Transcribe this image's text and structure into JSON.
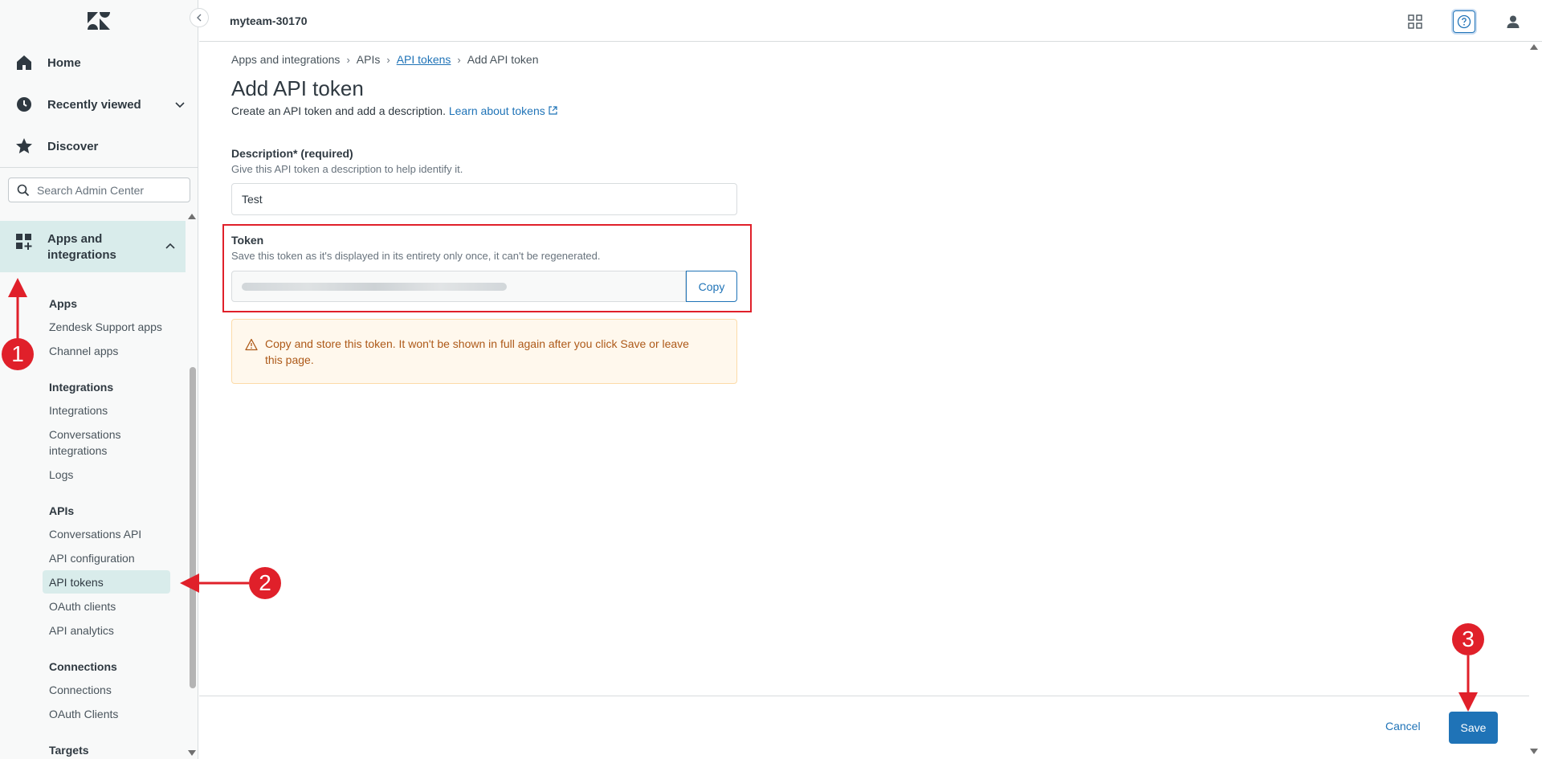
{
  "header": {
    "account": "myteam-30170"
  },
  "sidebar": {
    "nav": [
      {
        "label": "Home",
        "icon": "home-icon"
      },
      {
        "label": "Recently viewed",
        "icon": "clock-icon"
      },
      {
        "label": "Discover",
        "icon": "star-icon"
      }
    ],
    "search_placeholder": "Search Admin Center",
    "section": "Apps and integrations",
    "groups": [
      {
        "title": "Apps",
        "items": [
          "Zendesk Support apps",
          "Channel apps"
        ]
      },
      {
        "title": "Integrations",
        "items": [
          "Integrations",
          "Conversations integrations",
          "Logs"
        ]
      },
      {
        "title": "APIs",
        "items": [
          "Conversations API",
          "API configuration",
          "API tokens",
          "OAuth clients",
          "API analytics"
        ]
      },
      {
        "title": "Connections",
        "items": [
          "Connections",
          "OAuth Clients"
        ]
      },
      {
        "title": "Targets",
        "items": []
      }
    ],
    "active_item": "API tokens"
  },
  "breadcrumb": {
    "items": [
      "Apps and integrations",
      "APIs",
      "API tokens",
      "Add API token"
    ]
  },
  "page": {
    "title": "Add API token",
    "subtitle": "Create an API token and add a description.",
    "learn_link": "Learn about tokens"
  },
  "form": {
    "description_label": "Description* (required)",
    "description_hint": "Give this API token a description to help identify it.",
    "description_value": "Test",
    "token_label": "Token",
    "token_hint": "Save this token as it's displayed in its entirety only once, it can't be regenerated.",
    "copy_label": "Copy",
    "warning": "Copy and store this token. It won't be shown in full again after you click Save or leave this page."
  },
  "footer": {
    "cancel": "Cancel",
    "save": "Save"
  },
  "annotations": [
    "1",
    "2",
    "3"
  ],
  "colors": {
    "accent": "#1f73b7",
    "annotation": "#e0202a",
    "active_bg": "#d9eceb",
    "warning_text": "#ad5918"
  }
}
